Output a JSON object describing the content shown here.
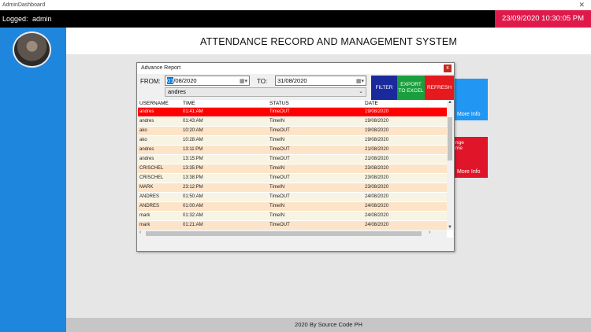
{
  "window": {
    "title": "AdminDashboard",
    "close_glyph": "✕"
  },
  "topbar": {
    "logged_label": "Logged:",
    "username": "admin",
    "datetime": "23/09/2020 10:30:05 PM"
  },
  "header": {
    "title": "ATTENDANCE RECORD AND MANAGEMENT SYSTEM"
  },
  "cards": {
    "more_info_1": "More Info",
    "more_info_2": "More Info",
    "partial_text": "nge\nme"
  },
  "footer": {
    "text": "2020 By Source Code PH"
  },
  "dialog": {
    "title": "Advance Report",
    "close_glyph": "x",
    "from_label": "FROM:",
    "from_day": "01",
    "from_rest": "/08/2020",
    "to_label": "TO:",
    "to_date": "31/08/2020",
    "user_select": "andres",
    "filter_label": "FILTER",
    "export_label": "EXPORT TO EXCEL",
    "refresh_label": "REFRESH",
    "columns": [
      "USERNAME",
      "TIME",
      "STATUS",
      "DATE"
    ],
    "rows": [
      [
        "andres",
        "01:41:AM",
        "TimeOUT",
        "19/08/2020"
      ],
      [
        "andres",
        "01:43:AM",
        "TimeIN",
        "19/08/2020"
      ],
      [
        "ako",
        "10:20:AM",
        "TimeOUT",
        "19/08/2020"
      ],
      [
        "ako",
        "10:28:AM",
        "TimeIN",
        "19/08/2020"
      ],
      [
        "andres",
        "13:11:PM",
        "TimeOUT",
        "21/08/2020"
      ],
      [
        "andres",
        "13:15:PM",
        "TimeOUT",
        "21/08/2020"
      ],
      [
        "CRISCHEL",
        "13:35:PM",
        "TimeIN",
        "23/08/2020"
      ],
      [
        "CRISCHEL",
        "13:38:PM",
        "TimeOUT",
        "23/08/2020"
      ],
      [
        "MARK",
        "23:12:PM",
        "TimeIN",
        "23/08/2020"
      ],
      [
        "ANDRES",
        "01:50:AM",
        "TimeOUT",
        "24/08/2020"
      ],
      [
        "ANDRES",
        "01:00:AM",
        "TimeIN",
        "24/08/2020"
      ],
      [
        "mark",
        "01:32:AM",
        "TimeIN",
        "24/08/2020"
      ],
      [
        "mark",
        "01:21:AM",
        "TimeOUT",
        "24/08/2020"
      ]
    ]
  },
  "colors": {
    "accent_blue": "#1f86de",
    "clock_red": "#e0194b",
    "filter": "#1a2a9c",
    "export": "#19a03d",
    "refresh": "#e6191f",
    "selected_row": "#ff0000"
  }
}
